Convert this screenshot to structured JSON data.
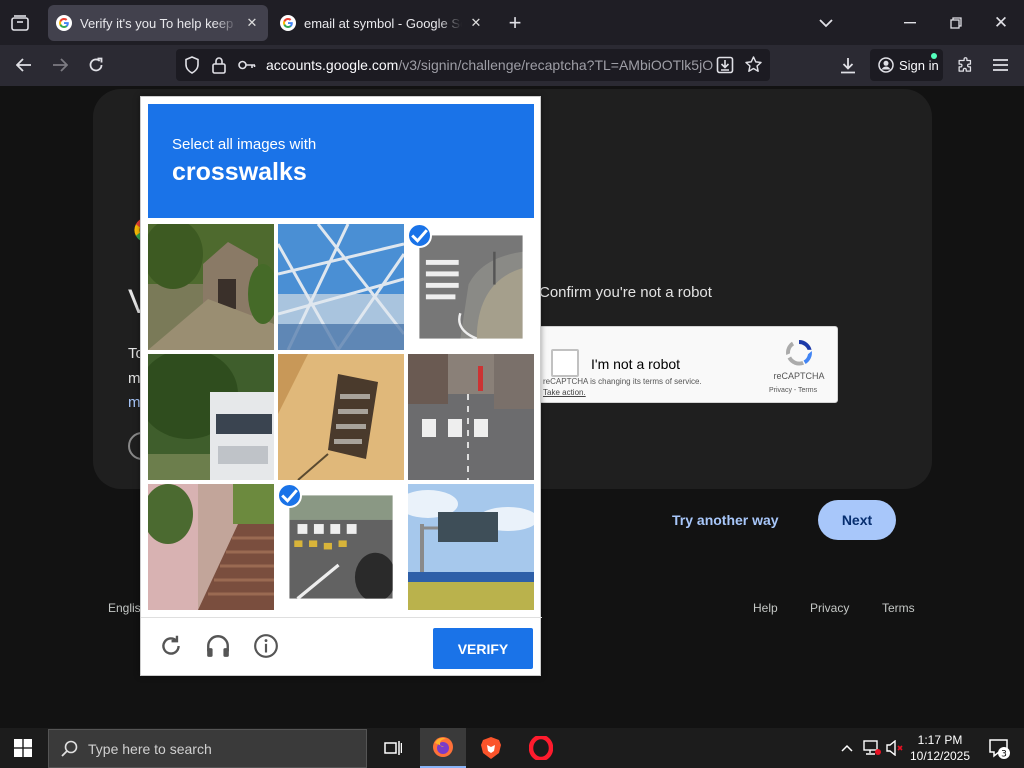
{
  "tabs": [
    {
      "title": "Verify it's you To help keep your",
      "active": true
    },
    {
      "title": "email at symbol - Google Search",
      "active": false
    }
  ],
  "url": {
    "domain": "accounts.google.com",
    "path": "/v3/signin/challenge/recaptcha?TL=AMbiOOTlk5jO"
  },
  "toolbar": {
    "signin_label": "Sign in"
  },
  "page": {
    "confirm_text": "Confirm you're not a robot",
    "recaptcha": {
      "label": "I'm not a robot",
      "notice": "reCAPTCHA is changing its terms of service.",
      "take_action": "Take action.",
      "brand": "reCAPTCHA",
      "links": "Privacy - Terms"
    },
    "try_another": "Try another way",
    "next": "Next",
    "footer": {
      "language": "Englis",
      "help": "Help",
      "privacy": "Privacy",
      "terms": "Terms"
    },
    "obscured_letters": {
      "title": "V",
      "line1": "To",
      "line2": "m",
      "line3": "m"
    }
  },
  "captcha": {
    "instruction": "Select all images with",
    "object": "crosswalks",
    "tiles": [
      {
        "name": "house-lane",
        "selected": false
      },
      {
        "name": "steel-roof",
        "selected": false
      },
      {
        "name": "crosswalk-curve",
        "selected": true
      },
      {
        "name": "truck-trees",
        "selected": false
      },
      {
        "name": "wall-window",
        "selected": false
      },
      {
        "name": "street-crosswalk",
        "selected": false
      },
      {
        "name": "pink-stairs",
        "selected": false
      },
      {
        "name": "crosswalk-yellow",
        "selected": true
      },
      {
        "name": "highway-sign",
        "selected": false
      }
    ],
    "verify": "VERIFY"
  },
  "taskbar": {
    "search_placeholder": "Type here to search",
    "time": "1:17 PM",
    "date": "10/12/2025",
    "notifications": "3"
  }
}
